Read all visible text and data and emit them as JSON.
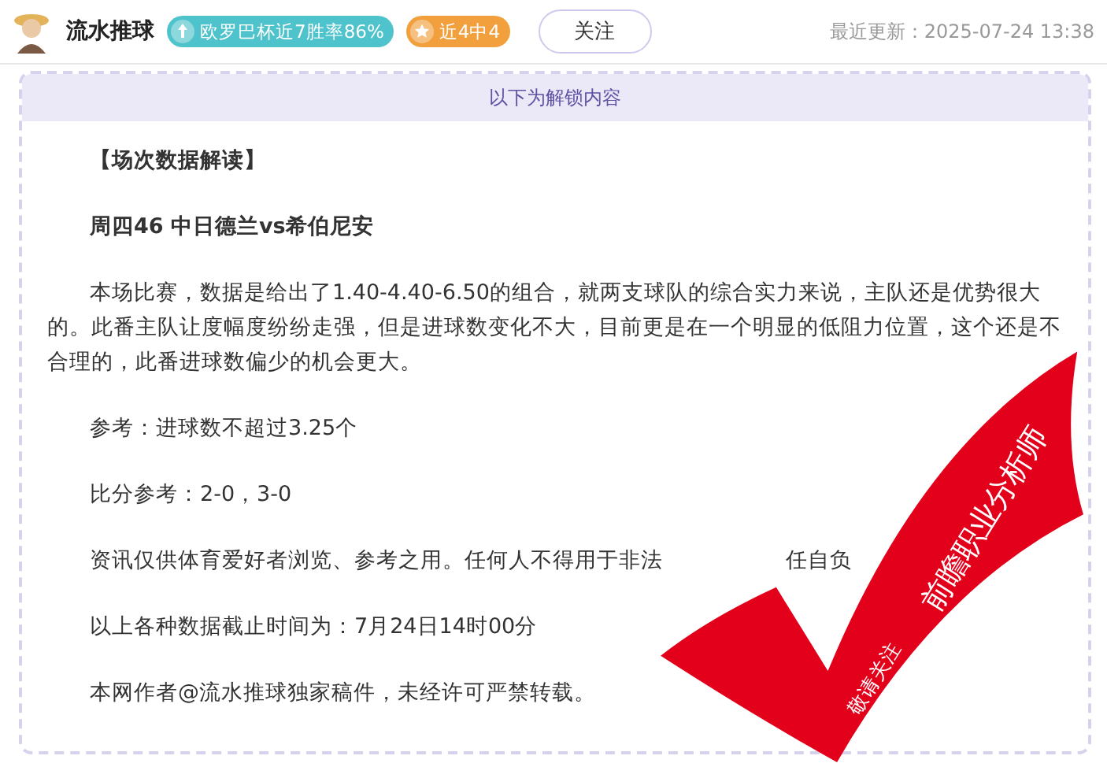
{
  "author": {
    "name": "流水推球",
    "badges": [
      {
        "kind": "trend",
        "text": "欧罗巴杯近7胜率86%",
        "color": "#4fc3cb"
      },
      {
        "kind": "star",
        "text": "近4中4",
        "color": "#f2a03d"
      }
    ],
    "follow_button": "关注",
    "updated": "最近更新：2025-07-24 13:38"
  },
  "content": {
    "banner": "以下为解锁内容",
    "paragraphs": [
      {
        "kind": "heading",
        "text": "【场次数据解读】"
      },
      {
        "kind": "title",
        "text": "周四46 中日德兰vs希伯尼安"
      },
      {
        "kind": "body",
        "text": "本场比赛，数据是给出了1.40-4.40-6.50的组合，就两支球队的综合实力来说，主队还是优势很大的。此番主队让度幅度纷纷走强，但是进球数变化不大，目前更是在一个明显的低阻力位置，这个还是不合理的，此番进球数偏少的机会更大。"
      },
      {
        "kind": "body",
        "text": "参考：进球数不超过3.25个"
      },
      {
        "kind": "body",
        "text": "比分参考：2-0，3-0"
      },
      {
        "kind": "covered",
        "parts": [
          "资讯仅供体育爱好者浏览、参考之用。任何人不得用于非法",
          "任自负"
        ]
      },
      {
        "kind": "body",
        "text": "以上各种数据截止时间为：7月24日14时00分"
      },
      {
        "kind": "body",
        "text": "本网作者@流水推球独家稿件，未经许可严禁转载。"
      }
    ],
    "stamp": {
      "small": "敬请关注",
      "large": "前瞻职业分析师"
    }
  }
}
